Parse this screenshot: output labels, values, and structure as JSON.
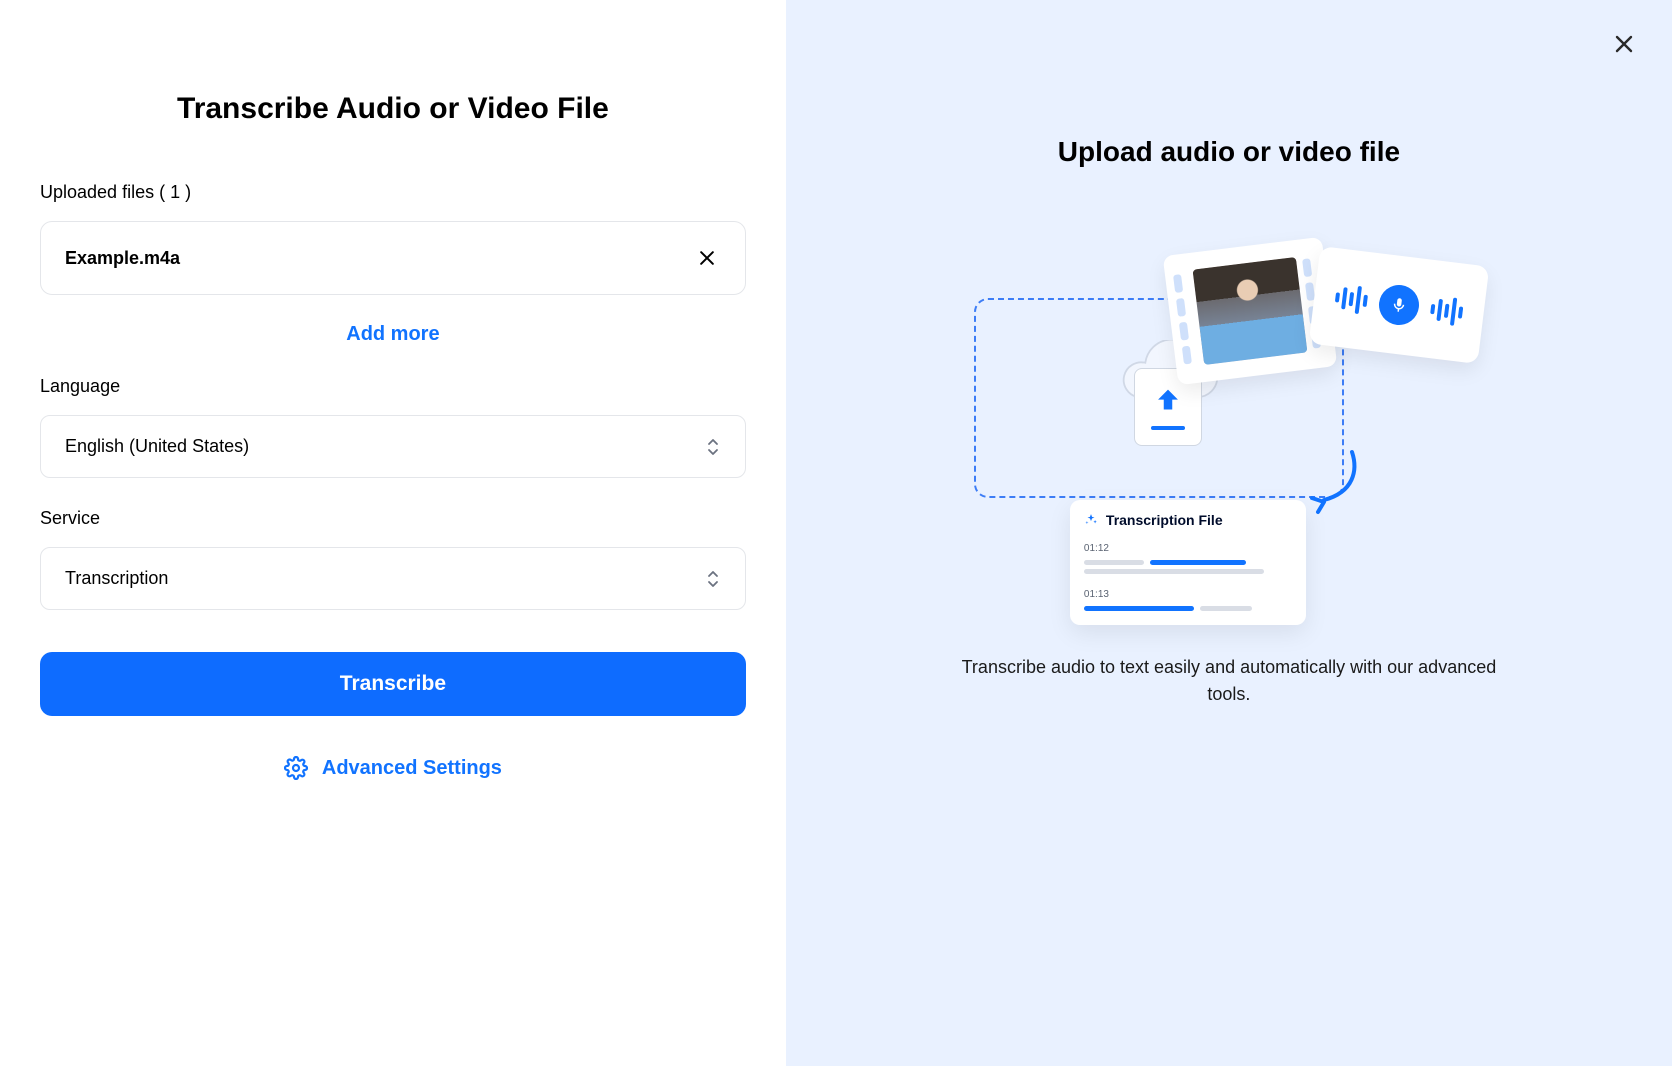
{
  "left": {
    "title": "Transcribe Audio or Video File",
    "uploaded_label": "Uploaded files ( 1 )",
    "file_name": "Example.m4a",
    "add_more": "Add more",
    "language_label": "Language",
    "language_value": "English (United States)",
    "service_label": "Service",
    "service_value": "Transcription",
    "transcribe_button": "Transcribe",
    "advanced_settings": "Advanced Settings"
  },
  "right": {
    "title": "Upload audio or video file",
    "trans_file_label": "Transcription File",
    "ts1": "01:12",
    "ts2": "01:13",
    "caption": "Transcribe audio to text easily and automatically with our advanced tools."
  }
}
